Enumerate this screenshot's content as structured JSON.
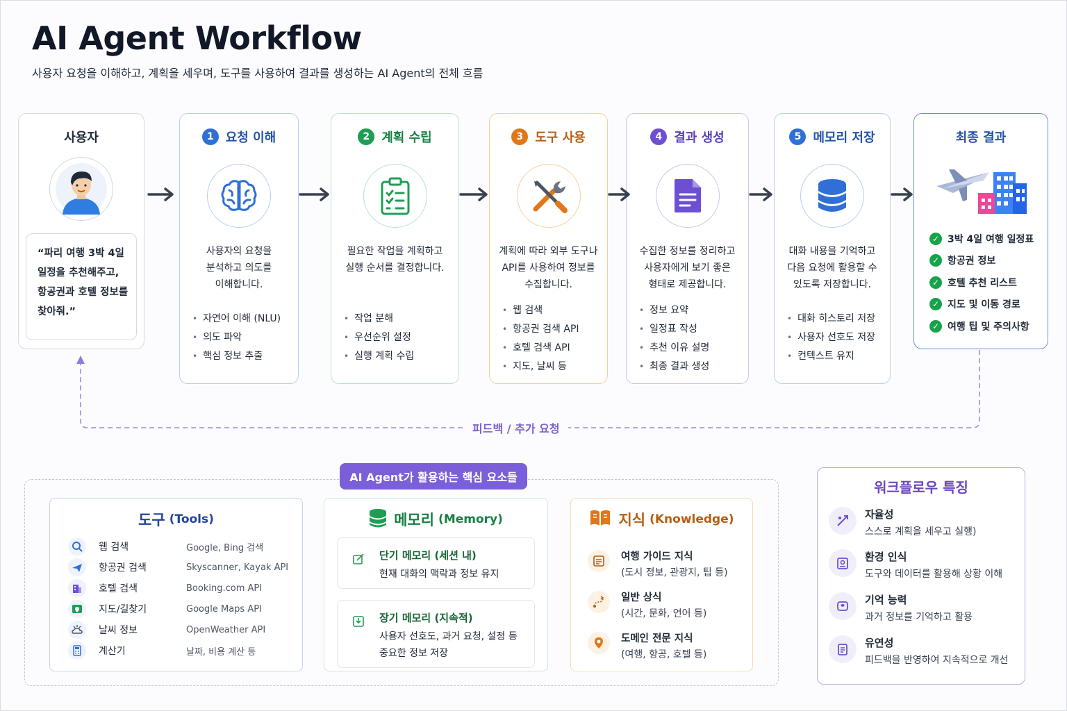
{
  "header": {
    "title": "AI Agent Workflow",
    "subtitle": "사용자 요청을 이해하고, 계획을 세우며, 도구를 사용하여 결과를 생성하는 AI Agent의 전체 흐름"
  },
  "user": {
    "label": "사용자",
    "quote_lines": [
      "“파리 여행 3박 4일",
      "일정을 추천해주고,",
      "항공권과 호텔 정보를",
      "찾아줘.”"
    ]
  },
  "steps": [
    {
      "num": "1",
      "title": "요청 이해",
      "color": "#2f6fd6",
      "icon": "brain-icon",
      "desc": [
        "사용자의 요청을",
        "분석하고 의도를",
        "이해합니다."
      ],
      "bullets": [
        "자연어 이해 (NLU)",
        "의도 파악",
        "핵심 정보 추출"
      ]
    },
    {
      "num": "2",
      "title": "계획 수립",
      "color": "#1f9d55",
      "icon": "clipboard-icon",
      "desc": [
        "필요한 작업을 계획하고",
        "실행 순서를 결정합니다."
      ],
      "bullets": [
        "작업 분해",
        "우선순위 설정",
        "실행 계획 수립"
      ]
    },
    {
      "num": "3",
      "title": "도구 사용",
      "color": "#e0781a",
      "icon": "tools-icon",
      "desc": [
        "계획에 따라 외부 도구나",
        "API를 사용하여 정보를",
        "수집합니다."
      ],
      "bullets": [
        "웹 검색",
        "항공권 검색 API",
        "호텔 검색 API",
        "지도, 날씨 등"
      ]
    },
    {
      "num": "4",
      "title": "결과 생성",
      "color": "#6d4fd4",
      "icon": "document-icon",
      "desc": [
        "수집한 정보를 정리하고",
        "사용자에게 보기 좋은",
        "형태로 제공합니다."
      ],
      "bullets": [
        "정보 요약",
        "일정표 작성",
        "추천 이유 설명",
        "최종 결과 생성"
      ]
    },
    {
      "num": "5",
      "title": "메모리 저장",
      "color": "#2f6fd6",
      "icon": "database-icon",
      "desc": [
        "대화 내용을 기억하고",
        "다음 요청에 활용할 수",
        "있도록 저장합니다."
      ],
      "bullets": [
        "대화 히스토리 저장",
        "사용자 선호도 저장",
        "컨텍스트 유지"
      ]
    }
  ],
  "final": {
    "title": "최종 결과",
    "items": [
      "3박 4일 여행 일정표",
      "항공권 정보",
      "호텔 추천 리스트",
      "지도 및 이동 경로",
      "여행 팁 및 주의사항"
    ]
  },
  "feedback": {
    "label": "피드백 / 추가 요청"
  },
  "core": {
    "tag": "AI Agent가 활용하는 핵심 요소들",
    "tools": {
      "title": "도구",
      "title_en": "(Tools)",
      "rows": [
        {
          "name": "웹 검색",
          "desc": "Google, Bing 검색",
          "icon": "search-icon"
        },
        {
          "name": "항공권 검색",
          "desc": "Skyscanner, Kayak API",
          "icon": "airplane-icon"
        },
        {
          "name": "호텔 검색",
          "desc": "Booking.com API",
          "icon": "hotel-icon"
        },
        {
          "name": "지도/길찾기",
          "desc": "Google Maps API",
          "icon": "map-icon"
        },
        {
          "name": "날씨 정보",
          "desc": "OpenWeather API",
          "icon": "weather-icon"
        },
        {
          "name": "계산기",
          "desc": "날짜, 비용 계산 등",
          "icon": "calculator-icon"
        }
      ]
    },
    "memory": {
      "title": "메모리",
      "title_en": "(Memory)",
      "short": {
        "title": "단기 메모리 (세션 내)",
        "lines": [
          "현재 대화의 맥락과 정보 유지"
        ]
      },
      "long": {
        "title": "장기 메모리 (지속적)",
        "lines": [
          "사용자 선호도, 과거 요청, 설정 등",
          "중요한 정보 저장"
        ]
      }
    },
    "knowledge": {
      "title": "지식",
      "title_en": "(Knowledge)",
      "rows": [
        {
          "title": "여행 가이드 지식",
          "text": "(도시 정보, 관광지, 팁 등)",
          "icon": "guide-icon"
        },
        {
          "title": "일반 상식",
          "text": "(시간, 문화, 언어 등)",
          "icon": "route-icon"
        },
        {
          "title": "도메인 전문 지식",
          "text": "(여행, 항공, 호텔 등)",
          "icon": "location-icon"
        }
      ]
    }
  },
  "features": {
    "title": "워크플로우 특징",
    "rows": [
      {
        "title": "자율성",
        "text": "스스로 계획을 세우고 실행)",
        "icon": "autonomy-icon"
      },
      {
        "title": "환경 인식",
        "text": "도구와 데이터를 활용해 상황 이해",
        "icon": "environment-icon"
      },
      {
        "title": "기억 능력",
        "text": "과거 정보를 기억하고 활용",
        "icon": "memory-icon"
      },
      {
        "title": "유연성",
        "text": "피드백을 반영하여 지속적으로 개선",
        "icon": "flexibility-icon"
      }
    ]
  },
  "colors": {
    "accent_purple": "#7b5fd9",
    "blue": "#2f6fd6",
    "green": "#1f9d55",
    "orange": "#e0781a",
    "purple": "#6d4fd4",
    "check_green": "#16a34a"
  }
}
